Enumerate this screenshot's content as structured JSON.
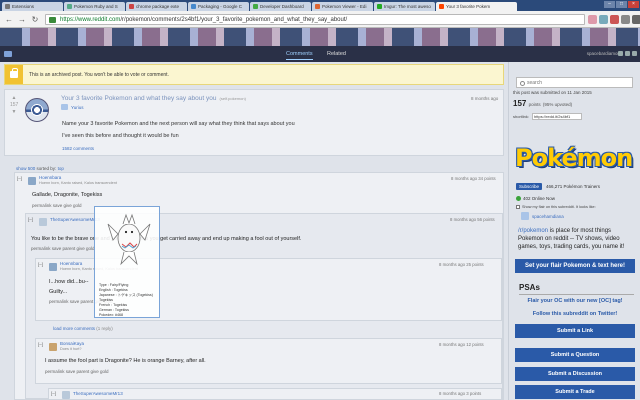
{
  "browser": {
    "tabs": [
      {
        "label": "Extensions"
      },
      {
        "label": "Pokemon Ruby and S"
      },
      {
        "label": "chrome package exte"
      },
      {
        "label": "Packaging - Google C"
      },
      {
        "label": "Developer Dashboard"
      },
      {
        "label": "Pokemon Viewer - Edi"
      },
      {
        "label": "Imgur: The most aweso"
      },
      {
        "label": "Your 3 favorite Pokem"
      }
    ],
    "url_host": "https://www.reddit.com",
    "url_path": "/r/pokemon/comments/2s4bf1/your_3_favorite_pokemon_and_what_they_say_about/"
  },
  "header": {
    "tab_comments": "Comments",
    "tab_related": "Related",
    "username": "spacebardiamon"
  },
  "archive_notice": "This is an archived post. You won't be able to vote or comment.",
  "post": {
    "score": "157",
    "title": "Your 3 favorite Pokemon and what they say about you",
    "domain": "(self.pokemon)",
    "time": "8 months ago",
    "author": "Yurius",
    "body1": "Name your 3 favorite Pokemon and the next person will say what they think that says about you",
    "body2": "I've seen this before and thought it would be fun",
    "comments_link": "1582 comments"
  },
  "sort": {
    "label": "show 500",
    "sorted": "sorted by:",
    "value": "top"
  },
  "comments": [
    {
      "toggle": "[–]",
      "author": "Hoennbara",
      "flair": "Hoenn born, Kanto raised, Kalos transcendent",
      "time": "8 months ago 34 points",
      "text": "Gallade, Dragonite, Togekiss",
      "links": "permalink   save   give gold"
    },
    {
      "toggle": "[–]",
      "author": "TheSuperAwesomeMr13",
      "time": "8 months ago 56 points",
      "text": "You like to be the brave one and you sometimes you get carried away and end up making a fool out of yourself.",
      "links": "permalink   save   parent   give gold"
    },
    {
      "toggle": "[–]",
      "author": "Hoennbara",
      "flair": "Hoenn born, Kanto raised, Kalos transcendent",
      "time": "8 months ago 25 points",
      "text": "I...how did...bu--",
      "text2": "Guilty...",
      "links": "permalink   save   parent   give gold"
    },
    {
      "more": "load more comments",
      "more_count": "(1 reply)"
    },
    {
      "toggle": "[–]",
      "author": "BonsaiKaya",
      "flair": "Does it hurt?",
      "time": "8 months ago 12 points",
      "text": "I assume the fool part is Dragonite? He is orange Barney, after all.",
      "links": "permalink   save   parent   give gold"
    },
    {
      "toggle": "[–]",
      "author": "TheSuperAwesomeMr13",
      "time": "8 months ago 3 points"
    }
  ],
  "popup": {
    "lines": [
      "Type : Fairy/Flying",
      "English : Togekiss",
      "Japanese : トゲキッス (Togekiss)",
      "Togekiss",
      "French : Togekiss",
      "German : Togekiss",
      "Pokedex: #468"
    ]
  },
  "sidebar": {
    "search_placeholder": "search",
    "submitted": "this post was submitted on 11 Jan 2015",
    "points": "157",
    "points_label": "points",
    "upvoted": "(95% upvoted)",
    "shortlink_label": "shortlink:",
    "shortlink": "https://redd.it/2s4bf1",
    "logo_text": "Pokémon",
    "subscribe": "Subscribe",
    "subscribers": "466,271 Pokémon Trainers",
    "online": "402 Online Now",
    "show_flair": "Show my flair on this subreddit. It looks like:",
    "flair_user": "spacehamdiana",
    "desc_sr": "/r/pokemon",
    "desc": " is place for most things Pokemon on reddit -- TV shows, video games, toys, trading cards, you name it!",
    "flair_btn": "Set your flair Pokemon & text here!",
    "psas": "PSAs",
    "psa1": "Flair your OC with our new [OC] tag!",
    "psa2": "Follow this subreddit on Twitter!",
    "buttons": [
      "Submit a Link",
      "Submit a Question",
      "Submit a Discussion",
      "Submit a Trade"
    ]
  },
  "colors": {
    "accent": "#2a5aa8",
    "header_bg": "#2a3047",
    "link": "#3a6dbf"
  }
}
